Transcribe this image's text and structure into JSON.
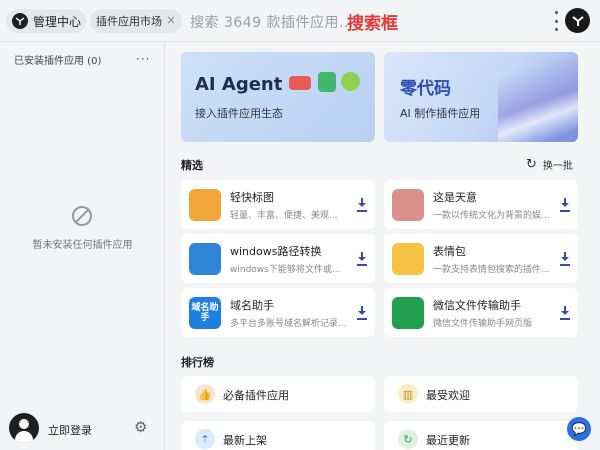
{
  "header": {
    "admin_tab_label": "管理中心",
    "market_tab_label": "插件应用市场",
    "tab_close_glyph": "×",
    "search_placeholder": "搜索 3649 款插件应用...",
    "search_annotation": "搜索框"
  },
  "sidebar": {
    "installed_title": "已安装插件应用 (0)",
    "more_label": "···",
    "empty_text": "暂未安装任何插件应用",
    "login_label": "立即登录",
    "settings_glyph": "⚙"
  },
  "banners": [
    {
      "title": "AI Agent",
      "subtitle": "接入插件应用生态"
    },
    {
      "title": "零代码",
      "subtitle": "AI 制作插件应用"
    }
  ],
  "featured": {
    "title": "精选",
    "refresh_label": "换一批",
    "refresh_glyph": "↻",
    "plugins": [
      {
        "name": "轻快标图",
        "desc": "轻量、丰富、便捷、美观...",
        "icon": "image-annotate-icon",
        "color": "#f2a63a"
      },
      {
        "name": "这是天意",
        "desc": "一款以传统文化为背景的娱...",
        "icon": "flower-icon",
        "color": "#d98f8a"
      },
      {
        "name": "windows路径转换",
        "desc": "windows下能够将文件或...",
        "icon": "path-convert-icon",
        "color": "#2f86d8"
      },
      {
        "name": "表情包",
        "desc": "一款支持表情包搜索的插件...",
        "icon": "emoji-icon",
        "color": "#f6c244"
      },
      {
        "name": "域名助手",
        "desc": "多平台多账号域名解析记录...",
        "icon": "domain-icon",
        "color": "#1e7fe0",
        "icon_text": "域名助手"
      },
      {
        "name": "微信文件传输助手",
        "desc": "微信文件传输助手网页版",
        "icon": "wechat-file-icon",
        "color": "#22a050"
      }
    ]
  },
  "ranking": {
    "title": "排行榜",
    "items": [
      {
        "label": "必备插件应用",
        "icon": "thumbs-up-icon",
        "bg": "#fbe4d2",
        "fg": "#e07c2e",
        "glyph": "👍"
      },
      {
        "label": "最受欢迎",
        "icon": "bar-chart-icon",
        "bg": "#f8f0cc",
        "fg": "#b89418",
        "glyph": "▥"
      },
      {
        "label": "最新上架",
        "icon": "new-icon",
        "bg": "#d9ecf8",
        "fg": "#2c86c9",
        "glyph": "⇡"
      },
      {
        "label": "最近更新",
        "icon": "update-icon",
        "bg": "#dcf1e0",
        "fg": "#36a55a",
        "glyph": "↻"
      }
    ]
  },
  "chat": {
    "glyph": "💬"
  }
}
